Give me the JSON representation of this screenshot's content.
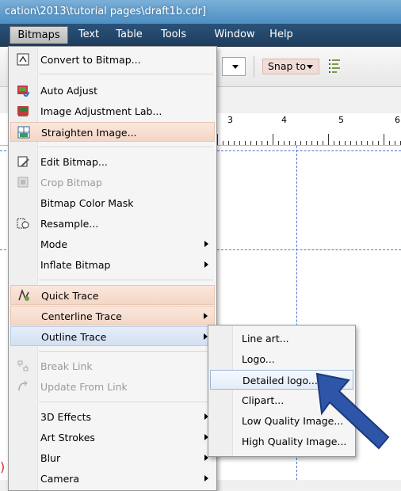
{
  "window": {
    "title": "cation\\2013\\tutorial pages\\draft1b.cdr]"
  },
  "menubar": {
    "items": [
      {
        "label": "Bitmaps",
        "active": true
      },
      {
        "label": "Text"
      },
      {
        "label": "Table"
      },
      {
        "label": "Tools"
      },
      {
        "label": "Window"
      },
      {
        "label": "Help"
      }
    ]
  },
  "toolbar": {
    "snap_to": "Snap to"
  },
  "ruler": {
    "labels": [
      "3",
      "4",
      "5",
      "6"
    ]
  },
  "bitmaps_menu": {
    "items": [
      {
        "label": "Convert to Bitmap...",
        "icon": "convert-bitmap-icon"
      },
      {
        "label": "Auto Adjust",
        "icon": "auto-adjust-icon"
      },
      {
        "label": "Image Adjustment Lab...",
        "icon": "adjustment-lab-icon"
      },
      {
        "label": "Straighten Image...",
        "icon": "straighten-icon"
      },
      {
        "label": "Edit Bitmap...",
        "icon": "edit-bitmap-icon"
      },
      {
        "label": "Crop Bitmap",
        "icon": "crop-icon"
      },
      {
        "label": "Bitmap Color Mask"
      },
      {
        "label": "Resample...",
        "icon": "resample-icon"
      },
      {
        "label": "Mode"
      },
      {
        "label": "Inflate Bitmap"
      },
      {
        "label": "Quick Trace",
        "icon": "quick-trace-icon"
      },
      {
        "label": "Centerline Trace"
      },
      {
        "label": "Outline Trace"
      },
      {
        "label": "Break Link",
        "icon": "break-link-icon"
      },
      {
        "label": "Update From Link",
        "icon": "update-link-icon"
      },
      {
        "label": "3D Effects"
      },
      {
        "label": "Art Strokes"
      },
      {
        "label": "Blur"
      },
      {
        "label": "Camera"
      }
    ]
  },
  "outline_trace_submenu": {
    "items": [
      {
        "label": "Line art..."
      },
      {
        "label": "Logo..."
      },
      {
        "label": "Detailed logo..."
      },
      {
        "label": "Clipart..."
      },
      {
        "label": "Low Quality Image..."
      },
      {
        "label": "High Quality Image..."
      }
    ]
  },
  "colors": {
    "pointer": "#2e56a8",
    "highlight_peach": "#f3d6c6",
    "guide": "#4a79c9"
  }
}
